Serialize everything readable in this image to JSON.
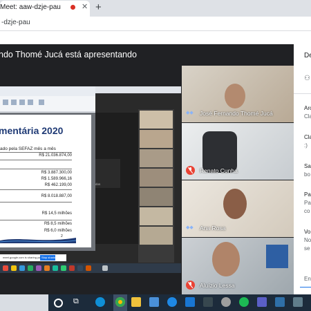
{
  "browser": {
    "tab_title": "Meet: aaw-dzje-pau",
    "tab_close": "✕",
    "new_tab": "+",
    "address": "-dzje-pau"
  },
  "meet": {
    "presenting_banner": "ndo Thomé Jucá está apresentando"
  },
  "shared_screen": {
    "document_title": "mentária 2020",
    "subtitle": "ado pela SEFAZ mês a mês",
    "values": [
      "R$ 21.036.874,00",
      "R$ 3.887.300,00",
      "R$ 1.589.966,16",
      "R$ 462.199,00",
      "R$ 8.018.887,00",
      "R$ 14,5 milhões",
      "R$ 8,5 milhões",
      "R$ 6,0 milhões"
    ],
    "page_number": "2",
    "notification": "meet.google.com is sharing your screen.",
    "notification_button": "Stop sharing",
    "card_text": "dos"
  },
  "participants": [
    {
      "name": "José Fernando Thomé Jucá",
      "muted": false
    },
    {
      "name": "Renato Cunha",
      "muted": true
    },
    {
      "name": "Ana Rosa",
      "muted": false
    },
    {
      "name": "Aluízio Lessa",
      "muted": true
    }
  ],
  "chat_panel": {
    "header": "De",
    "messages": [
      {
        "name": "Arc",
        "text": "Cla"
      },
      {
        "name": "Cla",
        "text": ":)"
      },
      {
        "name": "Sa",
        "text": "bo"
      },
      {
        "name": "Pa",
        "text": "Pa"
      },
      {
        "name": "",
        "text": "co"
      },
      {
        "name": "Vo",
        "text": "No"
      },
      {
        "name": "",
        "text": "se"
      }
    ],
    "input_placeholder": "Env"
  },
  "colors": {
    "meet_bg": "#202124",
    "mute_red": "#ea4335",
    "doc_title_blue": "#1f3a75",
    "taskbar": "#1c2b3b"
  },
  "taskbar_icons": [
    "search-icon",
    "task-view-icon",
    "edge-icon",
    "chrome-icon",
    "file-explorer-icon",
    "store-icon",
    "edge-icon",
    "mail-icon",
    "camera-icon",
    "tool-icon",
    "spotify-icon",
    "teams-icon",
    "photos-icon",
    "app-icon"
  ]
}
